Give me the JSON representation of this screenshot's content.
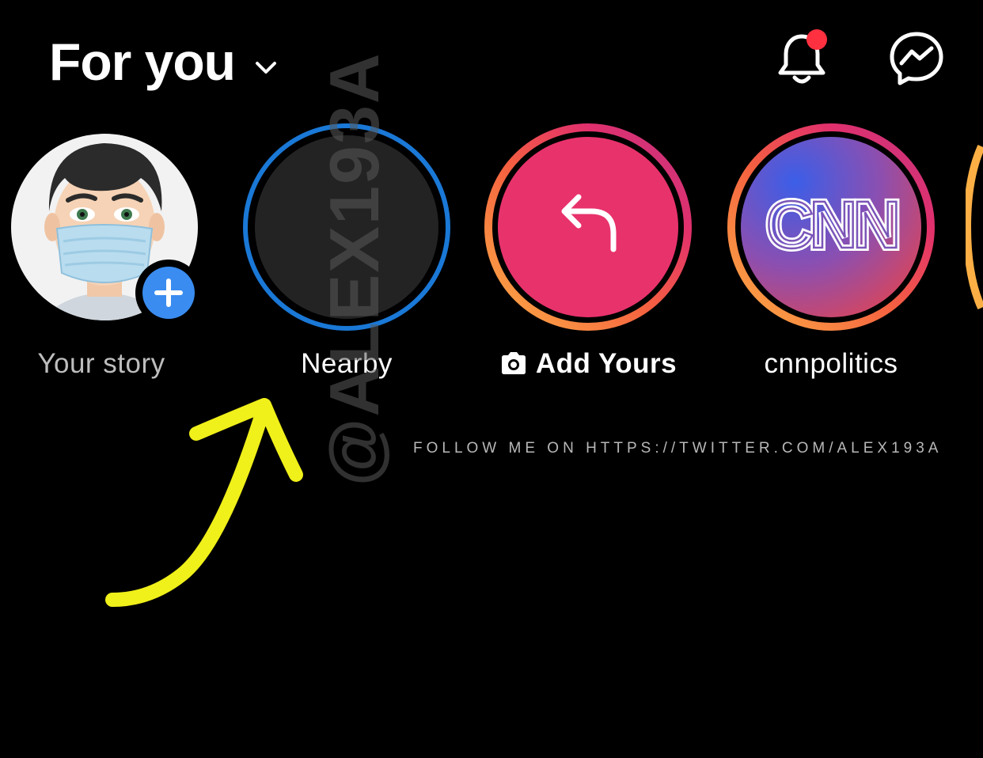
{
  "header": {
    "feed_title": "For you",
    "icons": [
      "chevron-down-icon",
      "bell-icon",
      "messenger-icon"
    ],
    "has_unread_notification": true
  },
  "stories": [
    {
      "label": "Your story",
      "type": "own",
      "badge": "add-icon"
    },
    {
      "label": "Nearby",
      "type": "nearby"
    },
    {
      "label": "Add Yours",
      "type": "add-yours",
      "icon": "camera-icon"
    },
    {
      "label": "cnnpolitics",
      "type": "account",
      "avatar_text": "CNN"
    }
  ],
  "watermark": {
    "handle": "@ALEX193A",
    "follow": "FOLLOW ME ON HTTPS://TWITTER.COM/ALEX193A"
  },
  "colors": {
    "background": "#000000",
    "nearby_ring": "#1a78d6",
    "add_yours_fill": "#e8326c",
    "notification_dot": "#ff3040",
    "add_badge": "#3a8cf0",
    "annotation": "#f0f01a"
  }
}
